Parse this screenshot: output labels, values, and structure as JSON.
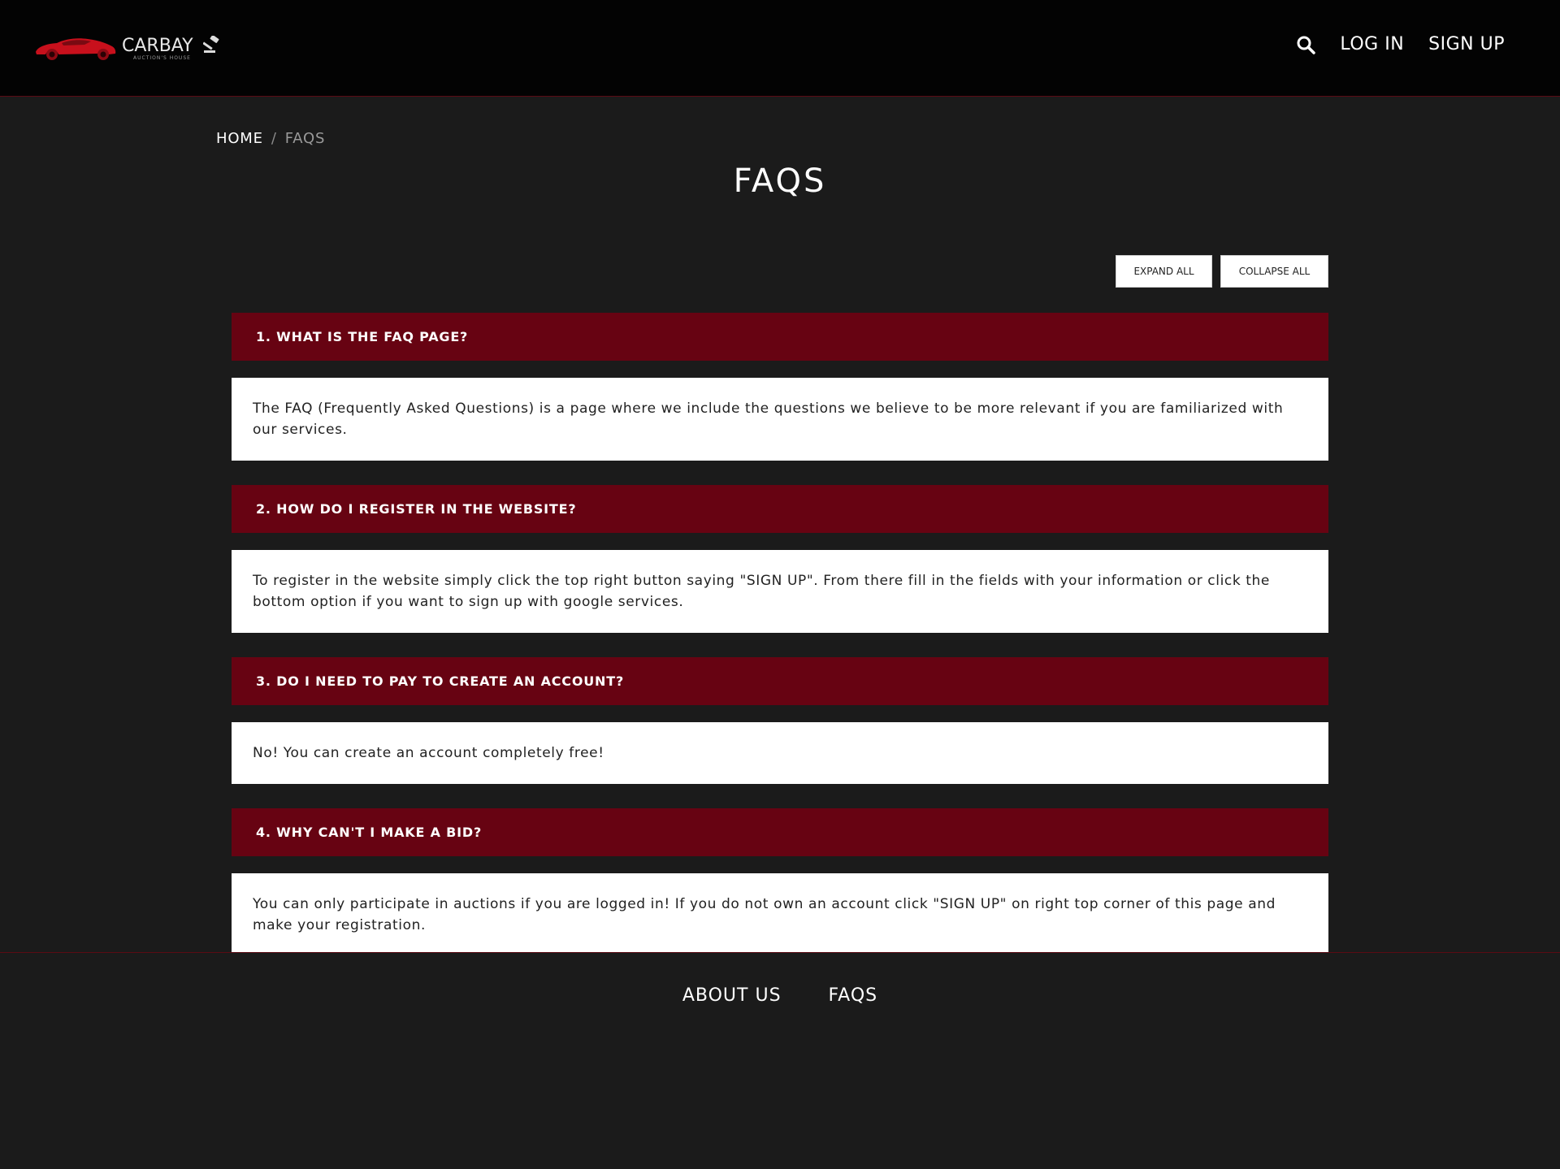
{
  "header": {
    "logo_text": "CARBAY",
    "logo_subtext": "AUCTION'S HOUSE",
    "nav": {
      "login_label": "LOG IN",
      "signup_label": "SIGN UP"
    }
  },
  "breadcrumb": {
    "home": "HOME",
    "separator": "/",
    "current": "FAQS"
  },
  "page": {
    "title": "FAQS"
  },
  "controls": {
    "expand_all": "EXPAND ALL",
    "collapse_all": "COLLAPSE ALL"
  },
  "faqs": [
    {
      "question": "1. WHAT IS THE FAQ PAGE?",
      "answer": "The FAQ (Frequently Asked Questions) is a page where we include the questions we believe to be more relevant if you are familiarized with our services."
    },
    {
      "question": "2. HOW DO I REGISTER IN THE WEBSITE?",
      "answer": "To register in the website simply click the top right button saying \"SIGN UP\". From there fill in the fields with your information or click the bottom option if you want to sign up with google services."
    },
    {
      "question": "3. DO I NEED TO PAY TO CREATE AN ACCOUNT?",
      "answer": "No! You can create an account completely free!"
    },
    {
      "question": "4. WHY CAN'T I MAKE A BID?",
      "answer": "You can only participate in auctions if you are logged in! If you do not own an account click \"SIGN UP\" on right top corner of this page and make your registration."
    }
  ],
  "footer": {
    "about_us": "ABOUT US",
    "faqs": "FAQS"
  },
  "colors": {
    "header_bg": "#030303",
    "page_bg": "#1b1b1b",
    "accent": "#670312",
    "divider": "#5a0b14",
    "logo_car": "#c8101c"
  },
  "icons": {
    "logo": "red-sports-car-icon",
    "gavel": "gavel-icon",
    "search": "search-icon"
  }
}
